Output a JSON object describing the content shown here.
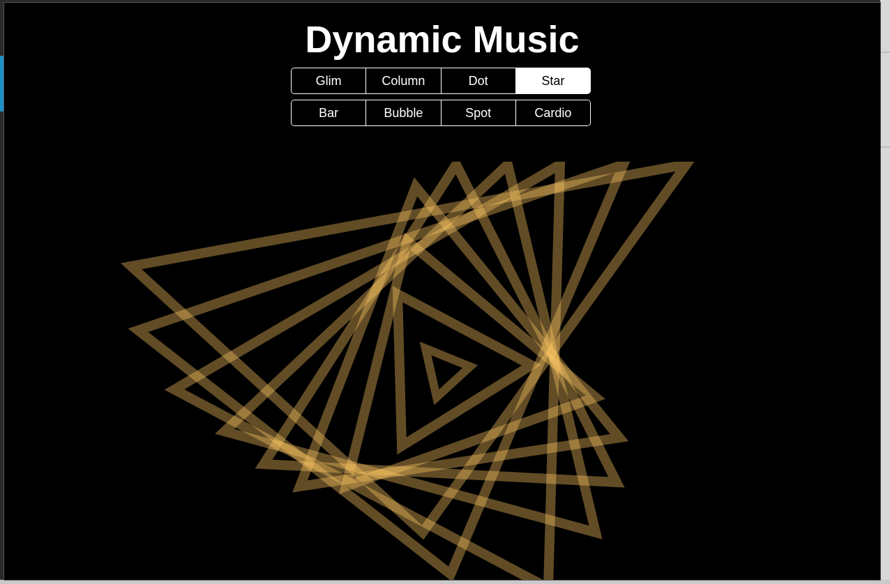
{
  "app": {
    "title": "Dynamic Music"
  },
  "modes": {
    "row1": [
      {
        "label": "Glim",
        "active": false
      },
      {
        "label": "Column",
        "active": false
      },
      {
        "label": "Dot",
        "active": false
      },
      {
        "label": "Star",
        "active": true
      }
    ],
    "row2": [
      {
        "label": "Bar",
        "active": false
      },
      {
        "label": "Bubble",
        "active": false
      },
      {
        "label": "Spot",
        "active": false
      },
      {
        "label": "Cardio",
        "active": false
      }
    ]
  },
  "visualizer": {
    "stroke_color": "#ffc864",
    "stroke_opacity": 0.38
  }
}
